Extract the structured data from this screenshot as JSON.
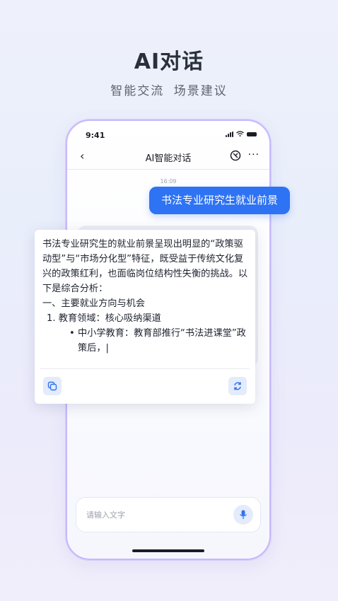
{
  "hero": {
    "title": "AI对话",
    "subtitle": "智能交流 场景建议"
  },
  "status_bar": {
    "time": "9:41"
  },
  "nav": {
    "back_glyph": "‹",
    "title": "AI智能对话",
    "more_glyph": "···"
  },
  "chat": {
    "timestamp": "16:09",
    "user_message": "书法专业研究生就业前景",
    "answer": {
      "paragraph": "书法专业研究生的就业前景呈现出明显的“政策驱动型”与“市场分化型”特征，既受益于传统文化复兴的政策红利，也面临岗位结构性失衡的挑战。以下是综合分析：",
      "section": "一、主要就业方向与机会",
      "list_item": "1. 教育领域：核心吸纳渠道",
      "bullet_mark": "•",
      "bullet": "中小学教育：教育部推行“书法进课堂”政策后，|"
    }
  },
  "input": {
    "placeholder": "请输入文字"
  },
  "colors": {
    "accent": "#2e73f3",
    "phone_border": "#c8b8ff",
    "icon_bg": "#e4ebfb"
  },
  "icons": {
    "back": "chevron-left-icon",
    "history": "history-icon",
    "more": "more-icon",
    "copy": "copy-icon",
    "refresh": "refresh-icon",
    "mic": "microphone-icon"
  }
}
